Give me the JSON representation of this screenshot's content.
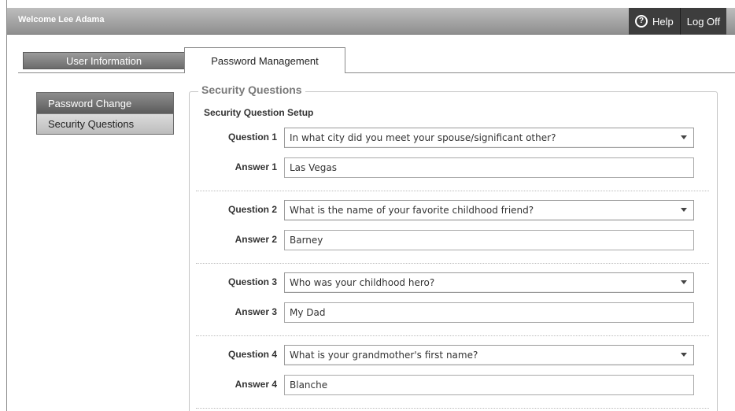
{
  "header": {
    "welcome": "Welcome Lee Adama",
    "help_label": "Help",
    "help_icon": "help-icon",
    "logoff_label": "Log Off"
  },
  "tabs": [
    {
      "label": "User Information"
    },
    {
      "label": "Password Management"
    }
  ],
  "sidebar": {
    "items": [
      {
        "label": "Password Change"
      },
      {
        "label": "Security Questions"
      }
    ]
  },
  "section": {
    "legend": "Security Questions",
    "subtitle": "Security Question Setup"
  },
  "questions": [
    {
      "q_label": "Question 1",
      "q_value": "In what city did you meet your spouse/significant other?",
      "a_label": "Answer 1",
      "a_value": "Las Vegas"
    },
    {
      "q_label": "Question 2",
      "q_value": "What is the name of your favorite childhood friend?",
      "a_label": "Answer 2",
      "a_value": "Barney"
    },
    {
      "q_label": "Question 3",
      "q_value": "Who was your childhood hero?",
      "a_label": "Answer 3",
      "a_value": "My Dad"
    },
    {
      "q_label": "Question 4",
      "q_value": "What is your grandmother's first name?",
      "a_label": "Answer 4",
      "a_value": "Blanche"
    }
  ]
}
